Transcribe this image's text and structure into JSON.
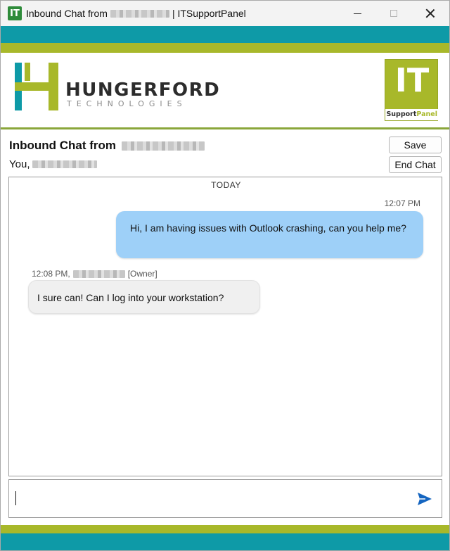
{
  "window": {
    "app_icon_text": "IT",
    "title_prefix": "Inbound Chat from",
    "title_suffix": "| ITSupportPanel",
    "controls": [
      "minimize-icon",
      "maximize-icon",
      "close-icon"
    ]
  },
  "brand": {
    "company_name": "HUNGERFORD",
    "company_sub": "TECHNOLOGIES",
    "badge_letters": "IT",
    "badge_sub_a": "Support",
    "badge_sub_b": "Panel",
    "colors": {
      "teal": "#0e9aa7",
      "green": "#a8b82a",
      "bubble_out": "#9ed0f8"
    }
  },
  "chat": {
    "heading": "Inbound Chat from",
    "you_label": "You,",
    "buttons": {
      "save": "Save",
      "end": "End Chat"
    }
  },
  "transcript": {
    "day_label": "TODAY",
    "messages": [
      {
        "direction": "outgoing",
        "time": "12:07 PM",
        "text": "Hi, I am having issues with Outlook crashing, can you help me?"
      },
      {
        "direction": "incoming",
        "time": "12:08 PM,",
        "role": "[Owner]",
        "text": "I sure can! Can I log into your workstation?"
      }
    ]
  },
  "composer": {
    "value": "",
    "send_icon": "send-icon"
  }
}
